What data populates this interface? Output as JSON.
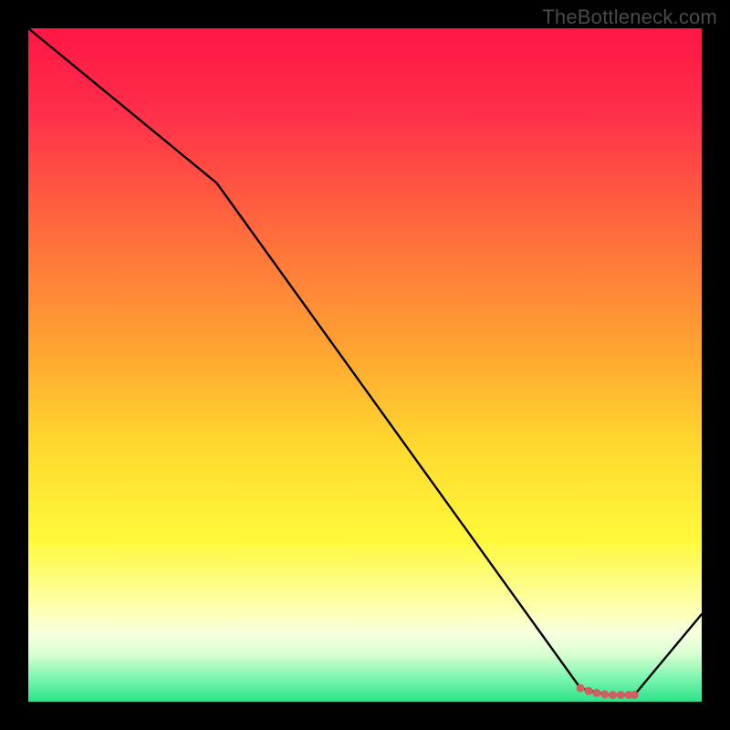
{
  "watermark": "TheBottleneck.com",
  "chart_data": {
    "type": "line",
    "title": "",
    "xlabel": "",
    "ylabel": "",
    "xlim": [
      0,
      100
    ],
    "ylim": [
      0,
      100
    ],
    "x": [
      0,
      28,
      82,
      86,
      90,
      100
    ],
    "values": [
      100,
      77,
      2,
      1,
      1,
      13
    ],
    "markers": {
      "x": [
        82,
        83.2,
        84.4,
        85.6,
        86.8,
        88,
        89.2,
        90
      ],
      "values": [
        2,
        1.6,
        1.3,
        1.1,
        1.0,
        1.0,
        1.0,
        1.0
      ]
    },
    "background_gradient": {
      "stops": [
        {
          "offset": 0.0,
          "color": "#ff1744"
        },
        {
          "offset": 0.12,
          "color": "#ff2d4a"
        },
        {
          "offset": 0.3,
          "color": "#ff6b3d"
        },
        {
          "offset": 0.48,
          "color": "#ffa531"
        },
        {
          "offset": 0.62,
          "color": "#ffd92e"
        },
        {
          "offset": 0.76,
          "color": "#fff93a"
        },
        {
          "offset": 0.86,
          "color": "#feffae"
        },
        {
          "offset": 0.9,
          "color": "#f7ffe0"
        },
        {
          "offset": 0.93,
          "color": "#d7ffd0"
        },
        {
          "offset": 0.965,
          "color": "#7cf5b0"
        },
        {
          "offset": 1.0,
          "color": "#2ce28b"
        }
      ]
    },
    "line_color": "#000000",
    "marker_color": "#d06060"
  }
}
